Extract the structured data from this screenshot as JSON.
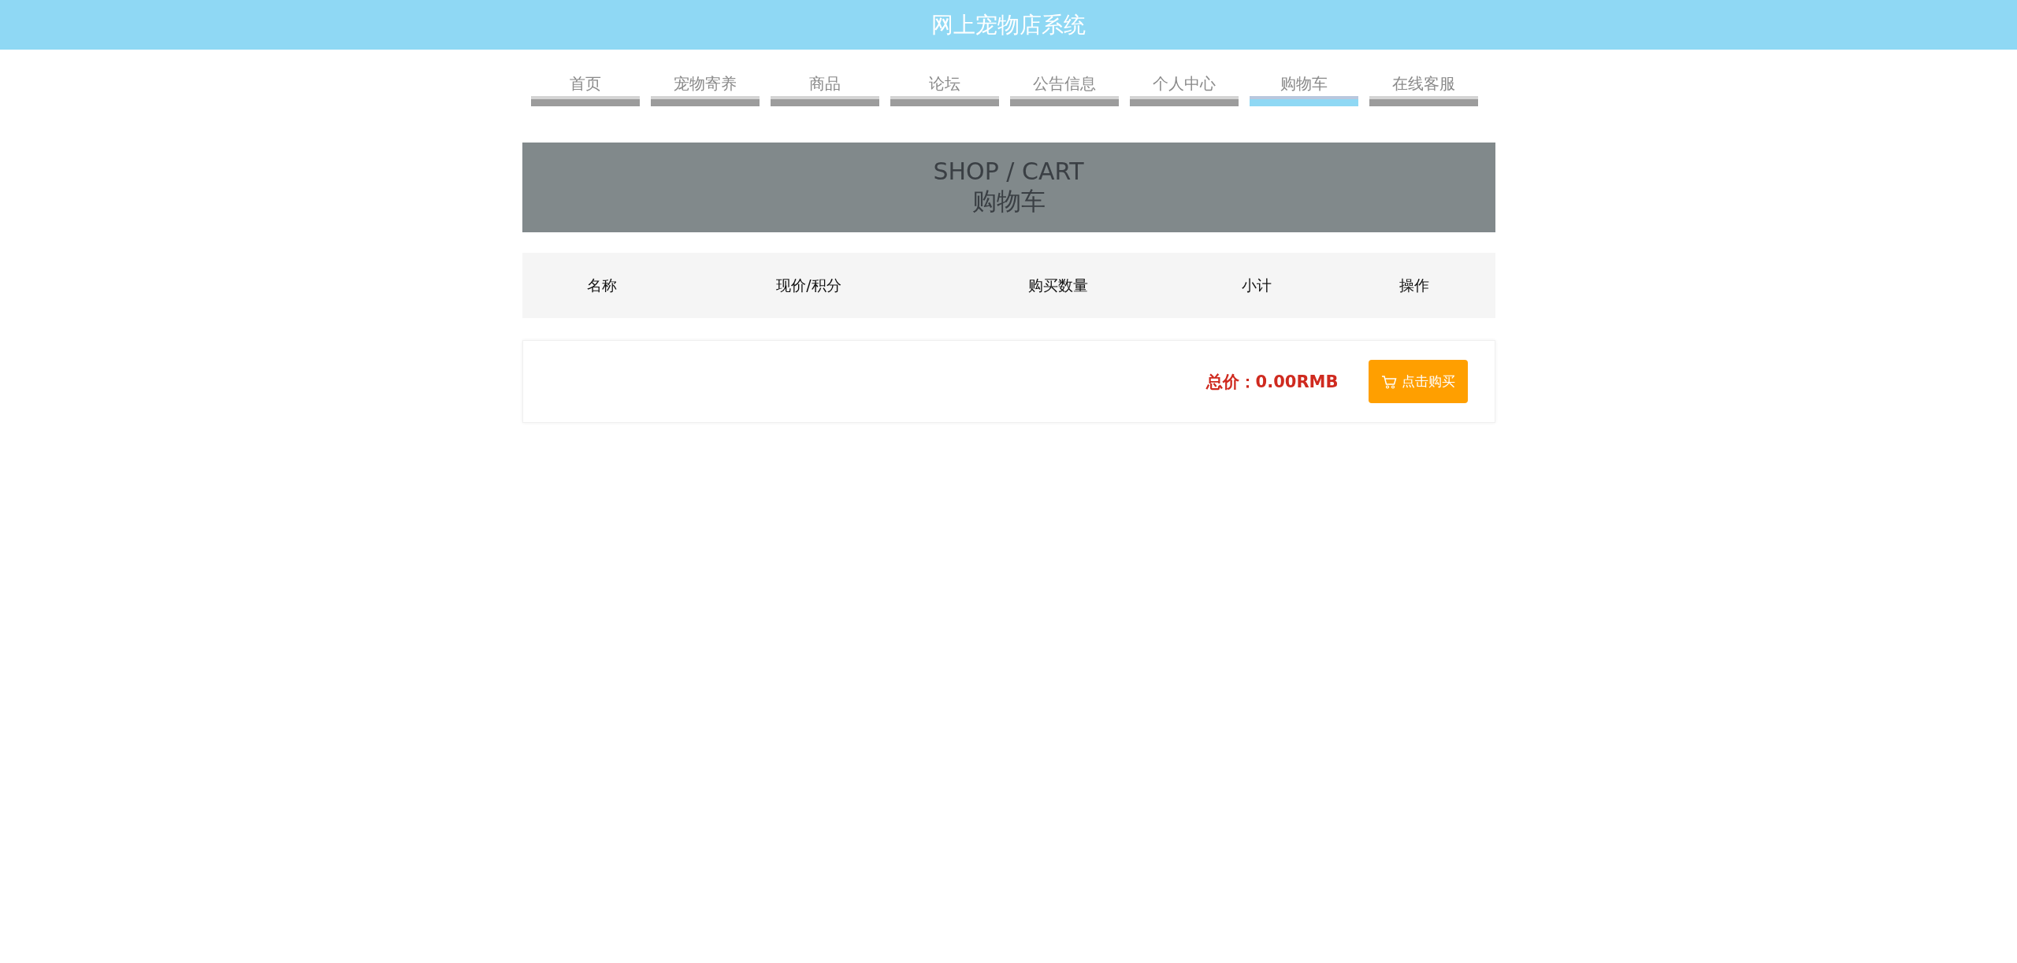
{
  "header": {
    "title": "网上宠物店系统"
  },
  "nav": [
    {
      "label": "首页",
      "selected": false
    },
    {
      "label": "宠物寄养",
      "selected": false
    },
    {
      "label": "商品",
      "selected": false
    },
    {
      "label": "论坛",
      "selected": false
    },
    {
      "label": "公告信息",
      "selected": false
    },
    {
      "label": "个人中心",
      "selected": false
    },
    {
      "label": "购物车",
      "selected": true
    },
    {
      "label": "在线客服",
      "selected": false
    }
  ],
  "banner": {
    "title": "SHOP / CART",
    "subtitle": "购物车"
  },
  "table": {
    "columns": [
      "名称",
      "现价/积分",
      "购买数量",
      "小计",
      "操作"
    ]
  },
  "summary": {
    "total": "总价：0.00RMB",
    "button": "点击购买"
  }
}
